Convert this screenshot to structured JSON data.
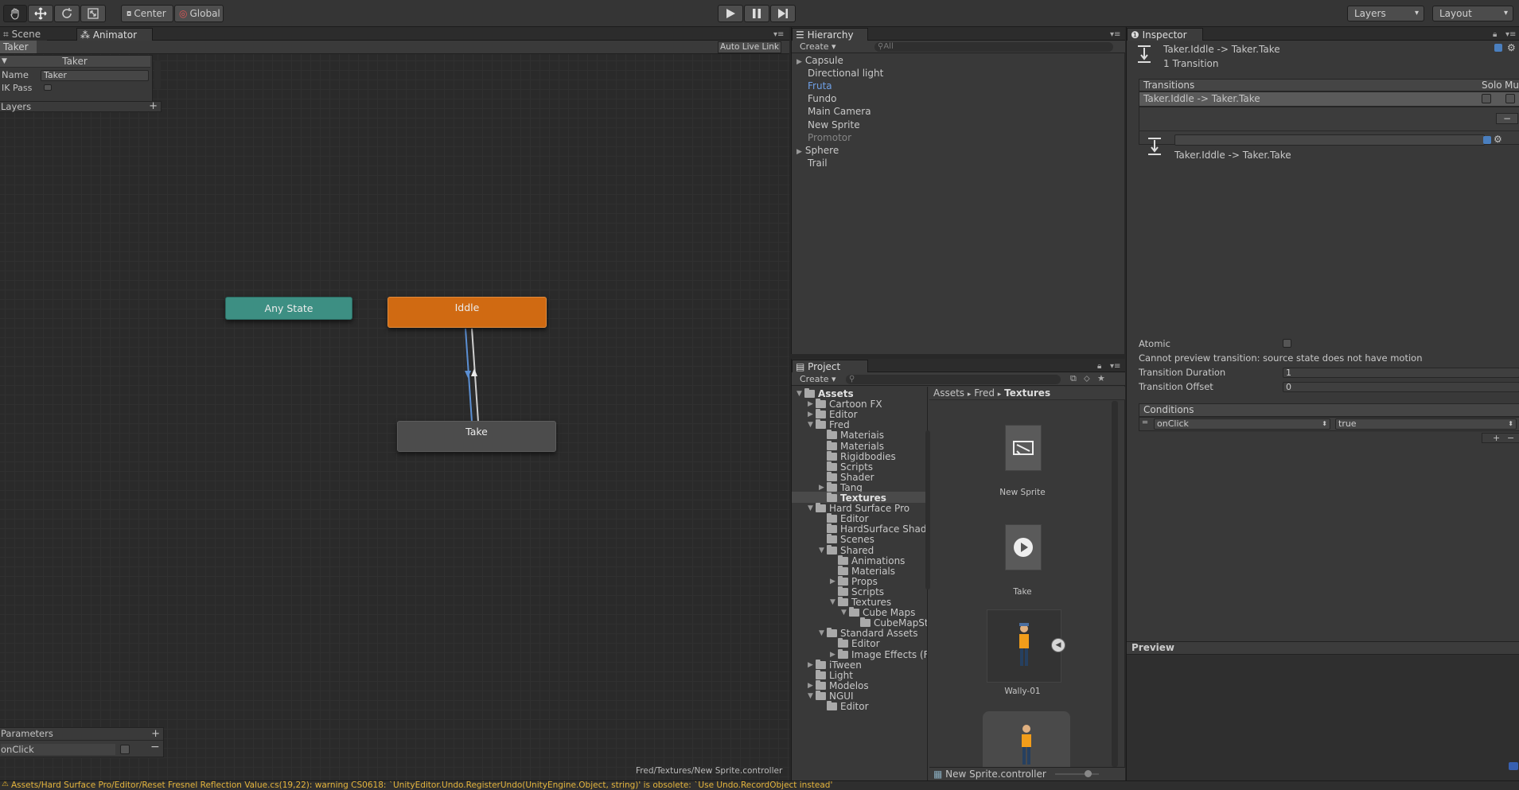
{
  "toolbar": {
    "pivot_label": "Center",
    "space_label": "Global",
    "layers_label": "Layers",
    "layout_label": "Layout"
  },
  "tabs": {
    "scene": "Scene",
    "animator": "Animator",
    "hierarchy": "Hierarchy",
    "project": "Project",
    "inspector": "Inspector"
  },
  "animator": {
    "breadcrumb": "Taker",
    "live_link": "Auto Live Link",
    "layer_panel": {
      "title": "Taker",
      "name_label": "Name",
      "name_value": "Taker",
      "ik_label": "IK Pass",
      "layers_label": "Layers"
    },
    "params_panel": {
      "title": "Parameters",
      "param_name": "onClick"
    },
    "states": {
      "any": "Any State",
      "idle": "Iddle",
      "take": "Take"
    },
    "status_path": "Fred/Textures/New Sprite.controller",
    "colors": {
      "any_state": "#3d8f83",
      "idle": "#d06a12",
      "take": "#4c4c4c"
    }
  },
  "hierarchy": {
    "create_label": "Create ▾",
    "search_placeholder": "All",
    "items": [
      {
        "label": "Capsule",
        "expandable": true,
        "color": "#c8c8c8"
      },
      {
        "label": "Directional light",
        "expandable": false,
        "color": "#c8c8c8"
      },
      {
        "label": "Fruta",
        "expandable": false,
        "color": "#6fa0e6"
      },
      {
        "label": "Fundo",
        "expandable": false,
        "color": "#c8c8c8"
      },
      {
        "label": "Main Camera",
        "expandable": false,
        "color": "#c8c8c8"
      },
      {
        "label": "New Sprite",
        "expandable": false,
        "color": "#c8c8c8"
      },
      {
        "label": "Promotor",
        "expandable": false,
        "color": "#858585"
      },
      {
        "label": "Sphere",
        "expandable": true,
        "color": "#c8c8c8"
      },
      {
        "label": "Trail",
        "expandable": false,
        "color": "#c8c8c8"
      }
    ]
  },
  "project": {
    "create_label": "Create ▾",
    "breadcrumb": {
      "a": "Assets",
      "b": "Fred",
      "c": "Textures"
    },
    "tree": [
      {
        "label": "Assets",
        "indent": 0,
        "arrow": "▼",
        "bold": true
      },
      {
        "label": "Cartoon FX",
        "indent": 1,
        "arrow": "▶"
      },
      {
        "label": "Editor",
        "indent": 1,
        "arrow": "▶"
      },
      {
        "label": "Fred",
        "indent": 1,
        "arrow": "▼"
      },
      {
        "label": "Materiais",
        "indent": 2,
        "arrow": ""
      },
      {
        "label": "Materials",
        "indent": 2,
        "arrow": ""
      },
      {
        "label": "Rigidbodies",
        "indent": 2,
        "arrow": ""
      },
      {
        "label": "Scripts",
        "indent": 2,
        "arrow": ""
      },
      {
        "label": "Shader",
        "indent": 2,
        "arrow": ""
      },
      {
        "label": "Tang",
        "indent": 2,
        "arrow": "▶"
      },
      {
        "label": "Textures",
        "indent": 2,
        "arrow": "",
        "selected": true
      },
      {
        "label": "Hard Surface Pro",
        "indent": 1,
        "arrow": "▼"
      },
      {
        "label": "Editor",
        "indent": 2,
        "arrow": ""
      },
      {
        "label": "HardSurface Shade",
        "indent": 2,
        "arrow": ""
      },
      {
        "label": "Scenes",
        "indent": 2,
        "arrow": ""
      },
      {
        "label": "Shared",
        "indent": 2,
        "arrow": "▼"
      },
      {
        "label": "Animations",
        "indent": 3,
        "arrow": ""
      },
      {
        "label": "Materials",
        "indent": 3,
        "arrow": ""
      },
      {
        "label": "Props",
        "indent": 3,
        "arrow": "▶"
      },
      {
        "label": "Scripts",
        "indent": 3,
        "arrow": ""
      },
      {
        "label": "Textures",
        "indent": 3,
        "arrow": "▼"
      },
      {
        "label": "Cube Maps",
        "indent": 4,
        "arrow": "▼"
      },
      {
        "label": "CubeMapSt",
        "indent": 5,
        "arrow": ""
      },
      {
        "label": "Standard Assets",
        "indent": 2,
        "arrow": "▼"
      },
      {
        "label": "Editor",
        "indent": 3,
        "arrow": ""
      },
      {
        "label": "Image Effects (F",
        "indent": 3,
        "arrow": "▶"
      },
      {
        "label": "iTween",
        "indent": 1,
        "arrow": "▶"
      },
      {
        "label": "Light",
        "indent": 1,
        "arrow": ""
      },
      {
        "label": "Modelos",
        "indent": 1,
        "arrow": "▶"
      },
      {
        "label": "NGUI",
        "indent": 1,
        "arrow": "▼"
      },
      {
        "label": "Editor",
        "indent": 2,
        "arrow": ""
      }
    ],
    "assets": {
      "a1": "New Sprite",
      "a2": "Take",
      "a3": "Wally-01"
    },
    "footer_file": "New Sprite.controller"
  },
  "inspector": {
    "title": "Taker.Iddle -> Taker.Take",
    "subtitle": "1 Transition",
    "transitions_header": "Transitions",
    "solo_label": "Solo",
    "mute_label": "Mute",
    "transition_item": "Taker.Iddle -> Taker.Take",
    "detail_name": "Taker.Iddle -> Taker.Take",
    "atomic_label": "Atomic",
    "preview_warning": "Cannot preview transition: source state does not have motion",
    "duration_label": "Transition Duration",
    "duration_value": "1",
    "offset_label": "Transition Offset",
    "offset_value": "0",
    "conditions_header": "Conditions",
    "cond_param": "onClick",
    "cond_value": "true",
    "preview_label": "Preview"
  },
  "console": {
    "message": "Assets/Hard Surface Pro/Editor/Reset Fresnel Reflection Value.cs(19,22): warning CS0618: `UnityEditor.Undo.RegisterUndo(UnityEngine.Object, string)' is obsolete: `Use Undo.RecordObject instead'"
  }
}
